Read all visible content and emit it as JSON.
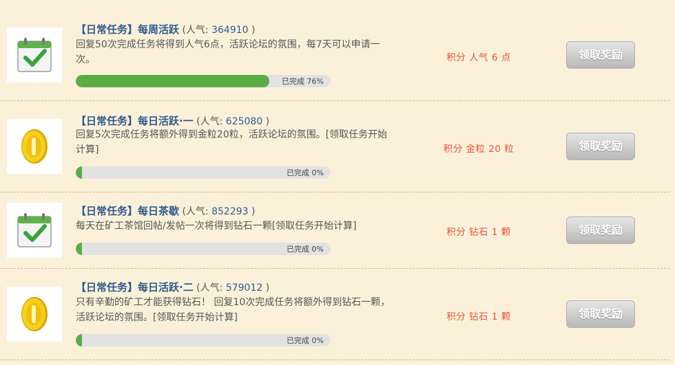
{
  "tasks": [
    {
      "title": "【日常任务】每周活跃",
      "pop_label": " (人气: ",
      "pop_value": "364910",
      "pop_close": " )",
      "desc": "回复50次完成任务将得到人气6点，活跃论坛的氛围，每7天可以申请一次。",
      "progress_text": "已完成 76%",
      "progress_percent": 76,
      "reward": "积分 人气 6 点",
      "button": "领取奖励",
      "icon": "calendar-check-icon"
    },
    {
      "title": "【日常任务】每日活跃·一",
      "pop_label": " (人气: ",
      "pop_value": "625080",
      "pop_close": " )",
      "desc": "回复5次完成任务将额外得到金粒20粒，活跃论坛的氛围。[领取任务开始计算]",
      "progress_text": "已完成 0%",
      "progress_percent": 0,
      "reward": "积分 金粒 20 粒",
      "button": "领取奖励",
      "icon": "gold-coin-icon"
    },
    {
      "title": "【日常任务】每日茶歇",
      "pop_label": " (人气: ",
      "pop_value": "852293",
      "pop_close": " )",
      "desc": "每天在矿工茶馆回帖/发帖一次将得到钻石一颗[领取任务开始计算]",
      "progress_text": "已完成 0%",
      "progress_percent": 0,
      "reward": "积分 钻石 1 颗",
      "button": "领取奖励",
      "icon": "calendar-check-icon"
    },
    {
      "title": "【日常任务】每日活跃·二",
      "pop_label": " (人气: ",
      "pop_value": "579012",
      "pop_close": " )",
      "desc": "只有辛勤的矿工才能获得钻石！ 回复10次完成任务将额外得到钻石一颗，活跃论坛的氛围。[领取任务开始计算]",
      "progress_text": "已完成 0%",
      "progress_percent": 0,
      "reward": "积分 钻石 1 颗",
      "button": "领取奖励",
      "icon": "gold-coin-icon"
    }
  ],
  "colors": {
    "background": "#fbf1da",
    "title": "#2f5a8f",
    "reward": "#e5533a",
    "progress": "#5aac47"
  }
}
